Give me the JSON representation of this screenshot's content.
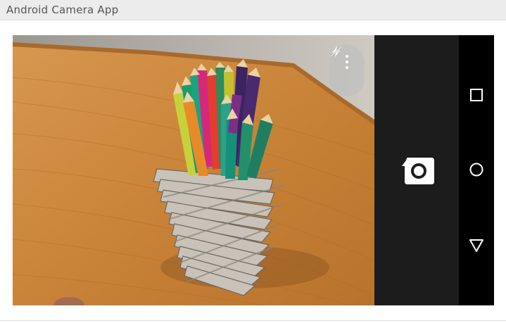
{
  "window": {
    "title": "Android Camera App"
  },
  "viewfinder": {
    "scene": "pencil-holder-photo"
  },
  "overlay": {
    "menu_icon": "vertical-ellipsis-icon",
    "flash_icon": "flash-off-icon"
  },
  "camera_controls": {
    "shutter_icon": "camera-shutter-icon"
  },
  "navigation": {
    "items": [
      {
        "name": "recents",
        "icon": "square-icon"
      },
      {
        "name": "home",
        "icon": "circle-icon"
      },
      {
        "name": "back",
        "icon": "triangle-icon"
      }
    ]
  },
  "colors": {
    "title_bar": "#ececec",
    "camera_panel": "#1c1c1c",
    "nav_bar": "#000000",
    "icon": "#ffffff"
  }
}
